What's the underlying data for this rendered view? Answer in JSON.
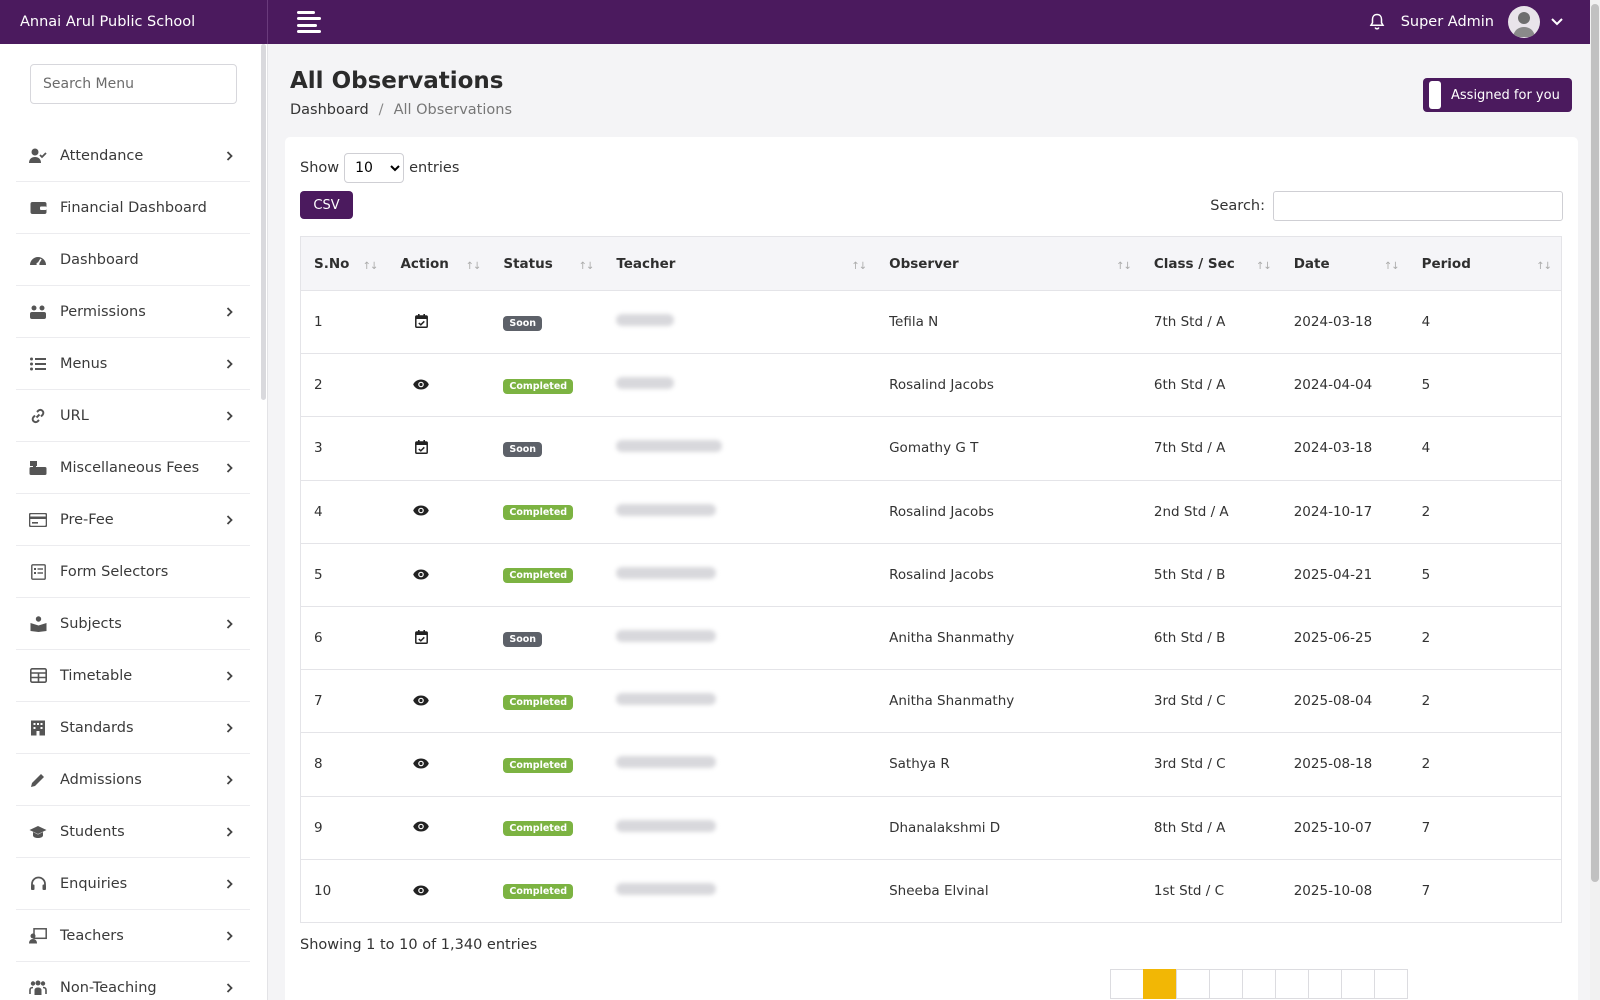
{
  "brand": "Annai Arul Public School",
  "header": {
    "user_name": "Super Admin"
  },
  "sidebar": {
    "search_placeholder": "Search Menu",
    "items": [
      {
        "label": "Attendance",
        "icon": "user-check-icon",
        "has_arrow": true
      },
      {
        "label": "Financial Dashboard",
        "icon": "wallet-icon",
        "has_arrow": false
      },
      {
        "label": "Dashboard",
        "icon": "gauge-icon",
        "has_arrow": false
      },
      {
        "label": "Permissions",
        "icon": "users-gear-icon",
        "has_arrow": true
      },
      {
        "label": "Menus",
        "icon": "list-icon",
        "has_arrow": true
      },
      {
        "label": "URL",
        "icon": "link-icon",
        "has_arrow": true
      },
      {
        "label": "Miscellaneous Fees",
        "icon": "cash-register-icon",
        "has_arrow": true
      },
      {
        "label": "Pre-Fee",
        "icon": "credit-card-icon",
        "has_arrow": true
      },
      {
        "label": "Form Selectors",
        "icon": "form-icon",
        "has_arrow": false
      },
      {
        "label": "Subjects",
        "icon": "book-reader-icon",
        "has_arrow": true
      },
      {
        "label": "Timetable",
        "icon": "table-icon",
        "has_arrow": true
      },
      {
        "label": "Standards",
        "icon": "building-icon",
        "has_arrow": true
      },
      {
        "label": "Admissions",
        "icon": "pen-icon",
        "has_arrow": true
      },
      {
        "label": "Students",
        "icon": "graduation-cap-icon",
        "has_arrow": true
      },
      {
        "label": "Enquiries",
        "icon": "headset-icon",
        "has_arrow": true
      },
      {
        "label": "Teachers",
        "icon": "chalkboard-teacher-icon",
        "has_arrow": true
      },
      {
        "label": "Non-Teaching",
        "icon": "people-group-icon",
        "has_arrow": true
      }
    ]
  },
  "page": {
    "title": "All Observations",
    "breadcrumb": {
      "root": "Dashboard",
      "sep": "/",
      "current": "All Observations"
    },
    "assigned_button": "Assigned for you"
  },
  "table_controls": {
    "show_label": "Show",
    "entries_value": "10",
    "entries_label": "entries",
    "csv_label": "CSV",
    "search_label": "Search:"
  },
  "table": {
    "columns": [
      "S.No",
      "Action",
      "Status",
      "Teacher",
      "Observer",
      "Class / Sec",
      "Date",
      "Period"
    ],
    "rows": [
      {
        "sno": "1",
        "action": "calendar-check-icon",
        "status": "Soon",
        "observer": "Tefila N",
        "class_sec": "7th Std / A",
        "date": "2024-03-18",
        "period": "4",
        "teacher_blur": 58
      },
      {
        "sno": "2",
        "action": "eye-icon",
        "status": "Completed",
        "observer": "Rosalind Jacobs",
        "class_sec": "6th Std / A",
        "date": "2024-04-04",
        "period": "5",
        "teacher_blur": 58
      },
      {
        "sno": "3",
        "action": "calendar-check-icon",
        "status": "Soon",
        "observer": "Gomathy G T",
        "class_sec": "7th Std / A",
        "date": "2024-03-18",
        "period": "4",
        "teacher_blur": 106
      },
      {
        "sno": "4",
        "action": "eye-icon",
        "status": "Completed",
        "observer": "Rosalind Jacobs",
        "class_sec": "2nd Std / A",
        "date": "2024-10-17",
        "period": "2",
        "teacher_blur": 100
      },
      {
        "sno": "5",
        "action": "eye-icon",
        "status": "Completed",
        "observer": "Rosalind Jacobs",
        "class_sec": "5th Std / B",
        "date": "2025-04-21",
        "period": "5",
        "teacher_blur": 100
      },
      {
        "sno": "6",
        "action": "calendar-check-icon",
        "status": "Soon",
        "observer": "Anitha Shanmathy",
        "class_sec": "6th Std / B",
        "date": "2025-06-25",
        "period": "2",
        "teacher_blur": 100
      },
      {
        "sno": "7",
        "action": "eye-icon",
        "status": "Completed",
        "observer": "Anitha Shanmathy",
        "class_sec": "3rd Std / C",
        "date": "2025-08-04",
        "period": "2",
        "teacher_blur": 100
      },
      {
        "sno": "8",
        "action": "eye-icon",
        "status": "Completed",
        "observer": "Sathya R",
        "class_sec": "3rd Std / C",
        "date": "2025-08-18",
        "period": "2",
        "teacher_blur": 100
      },
      {
        "sno": "9",
        "action": "eye-icon",
        "status": "Completed",
        "observer": "Dhanalakshmi D",
        "class_sec": "8th Std / A",
        "date": "2025-10-07",
        "period": "7",
        "teacher_blur": 100
      },
      {
        "sno": "10",
        "action": "eye-icon",
        "status": "Completed",
        "observer": "Sheeba Elvinal",
        "class_sec": "1st Std / C",
        "date": "2025-10-08",
        "period": "7",
        "teacher_blur": 100
      }
    ]
  },
  "footer": {
    "showing_text": "Showing 1 to 10 of 1,340 entries"
  },
  "colors": {
    "brand": "#4b1a5e",
    "completed": "#7cb342",
    "soon": "#5d6169",
    "page_active": "#f2b705"
  }
}
